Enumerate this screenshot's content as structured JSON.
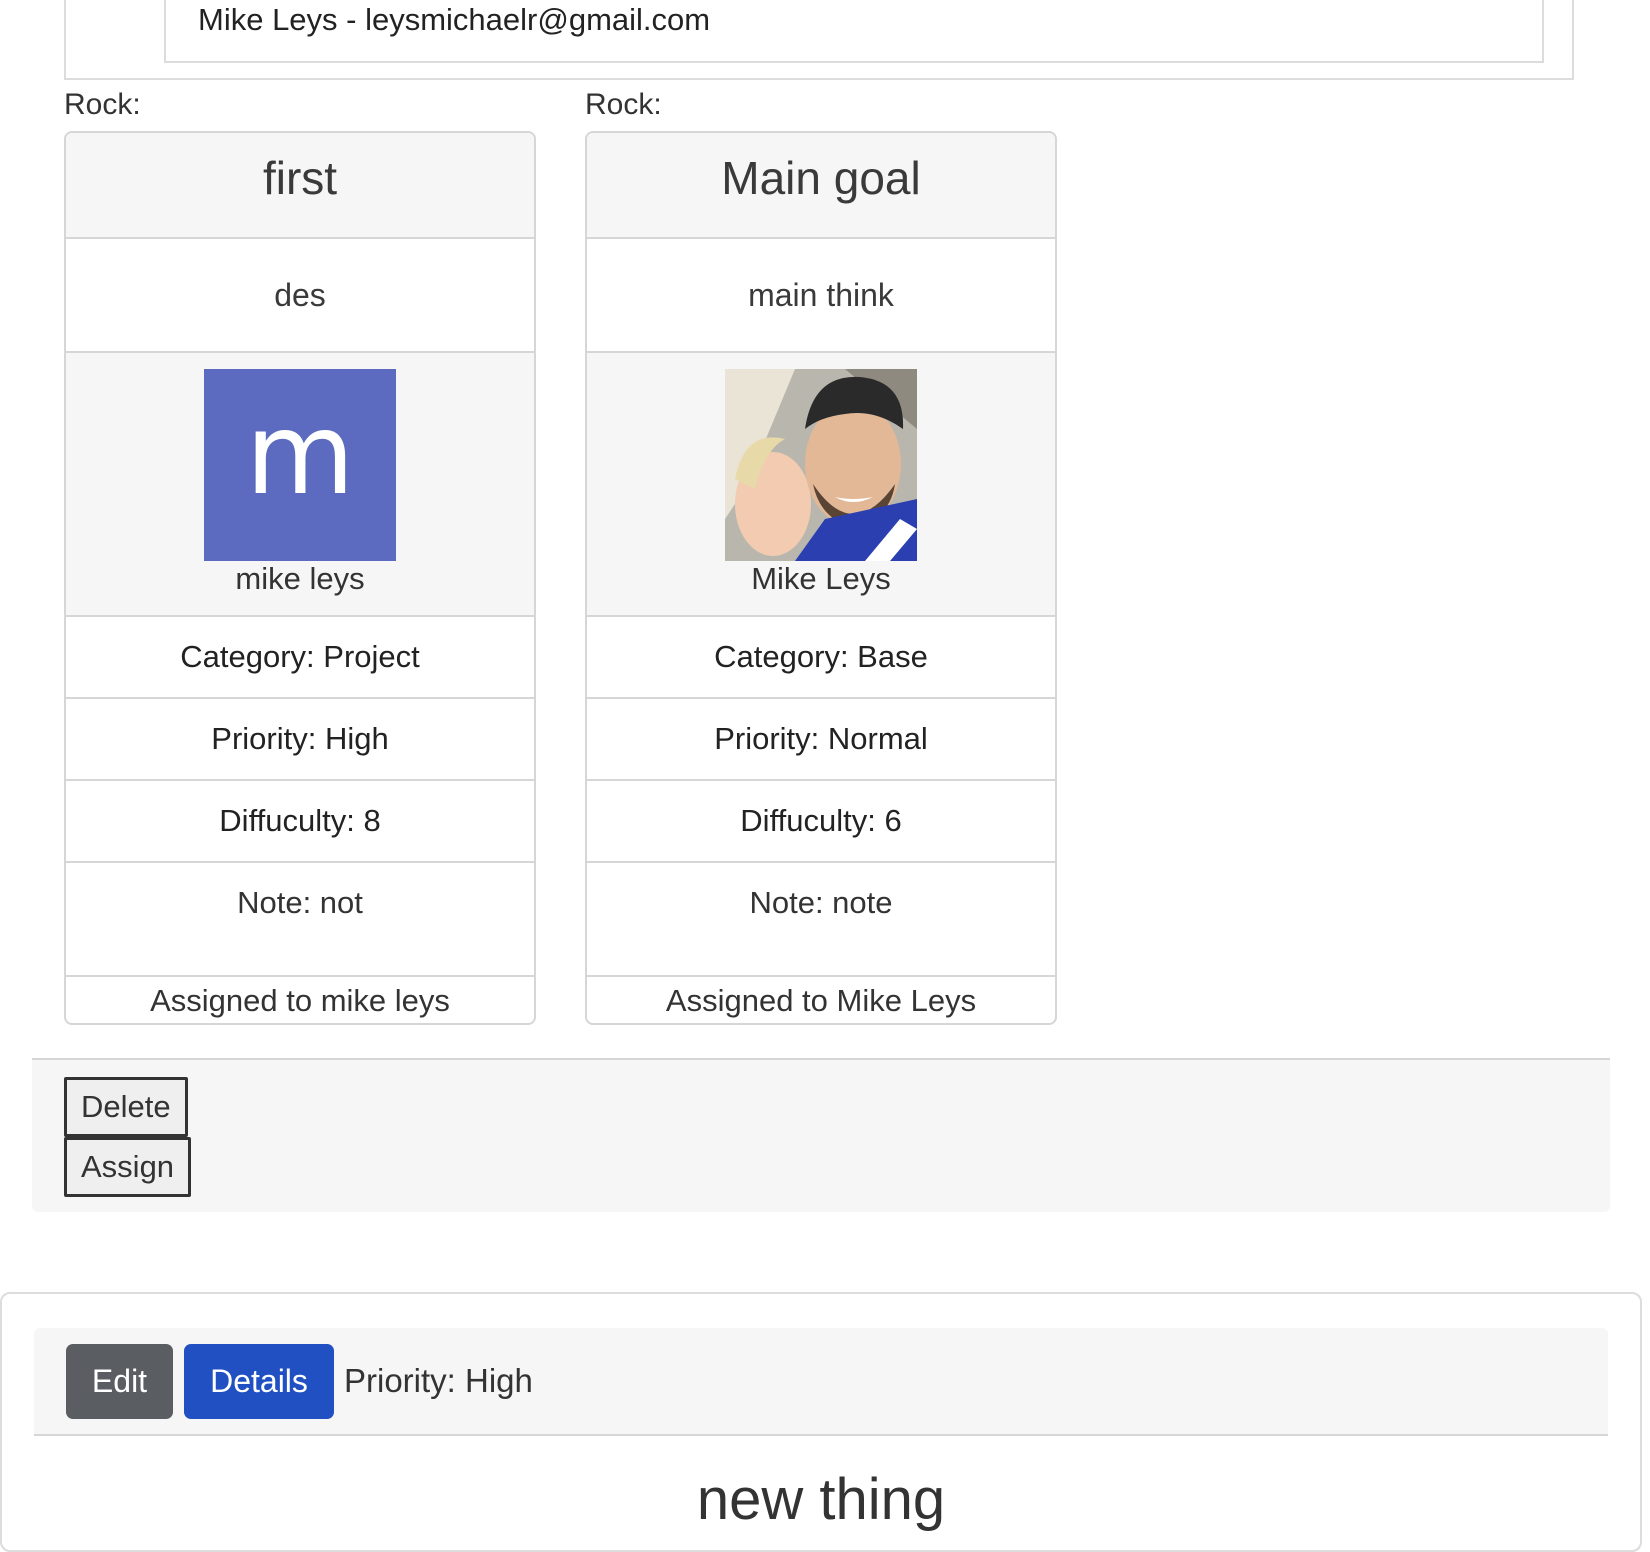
{
  "contact": {
    "line": "Mike Leys - leysmichaelr@gmail.com"
  },
  "rocks": [
    {
      "label": "Rock:",
      "title": "first",
      "description": "des",
      "avatar_type": "letter",
      "avatar_letter": "m",
      "avatar_color": "#5c6bc0",
      "user": "mike leys",
      "category": "Category: Project",
      "priority": "Priority: High",
      "difficulty": "Diffuculty: 8",
      "note": "Note: not",
      "assigned": "Assigned to mike leys"
    },
    {
      "label": "Rock:",
      "title": "Main goal",
      "description": "main think",
      "avatar_type": "photo",
      "user": "Mike Leys",
      "category": "Category: Base",
      "priority": "Priority: Normal",
      "difficulty": "Diffuculty: 6",
      "note": "Note: note",
      "assigned": "Assigned to Mike Leys"
    }
  ],
  "actions": {
    "delete_label": "Delete",
    "assign_label": "Assign"
  },
  "next_item": {
    "edit_label": "Edit",
    "details_label": "Details",
    "priority": "Priority: High",
    "title": "new thing"
  },
  "colors": {
    "edit_button": "#5a5e63",
    "details_button": "#2050c2"
  }
}
